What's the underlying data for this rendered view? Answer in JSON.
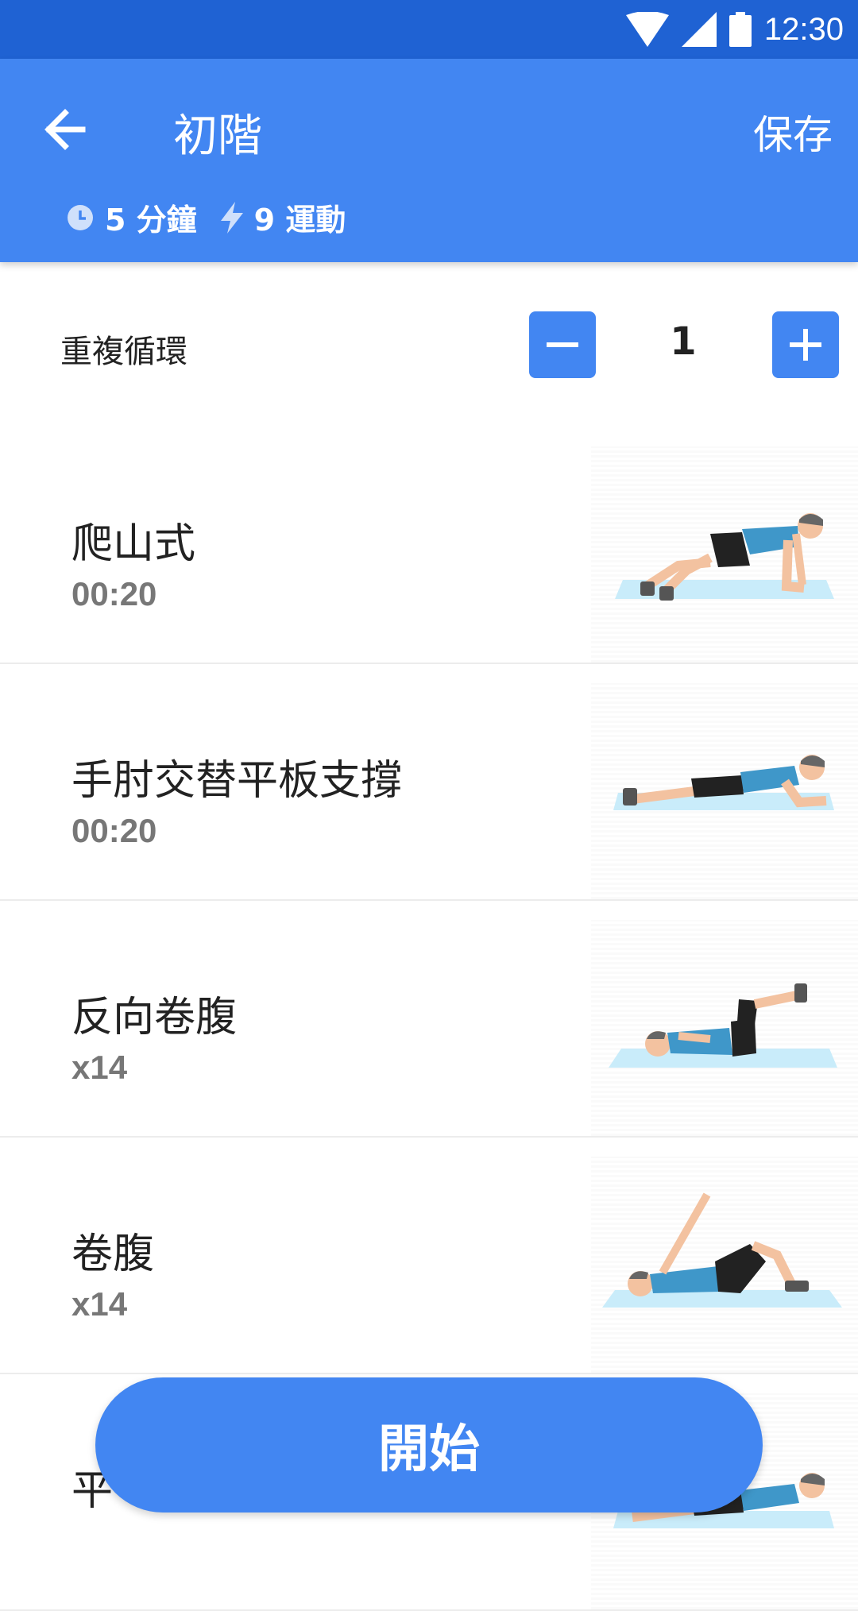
{
  "status_bar": {
    "time": "12:30"
  },
  "header": {
    "title": "初階",
    "save_label": "保存",
    "duration": "5 分鐘",
    "exercise_count": "9 運動"
  },
  "repeat": {
    "label": "重複循環",
    "value": "1"
  },
  "exercises": [
    {
      "name": "爬山式",
      "detail": "00:20",
      "illustration": "mountain-climber"
    },
    {
      "name": "手肘交替平板支撐",
      "detail": "00:20",
      "illustration": "elbow-plank"
    },
    {
      "name": "反向卷腹",
      "detail": "x14",
      "illustration": "reverse-crunch"
    },
    {
      "name": "卷腹",
      "detail": "x14",
      "illustration": "crunch"
    },
    {
      "name": "平",
      "detail": "",
      "illustration": "plank"
    }
  ],
  "start_button": {
    "label": "開始"
  },
  "colors": {
    "status_bar": "#1f62d3",
    "primary": "#4286f2",
    "mat": "#c9ecfa",
    "shirt": "#3f97c9"
  }
}
